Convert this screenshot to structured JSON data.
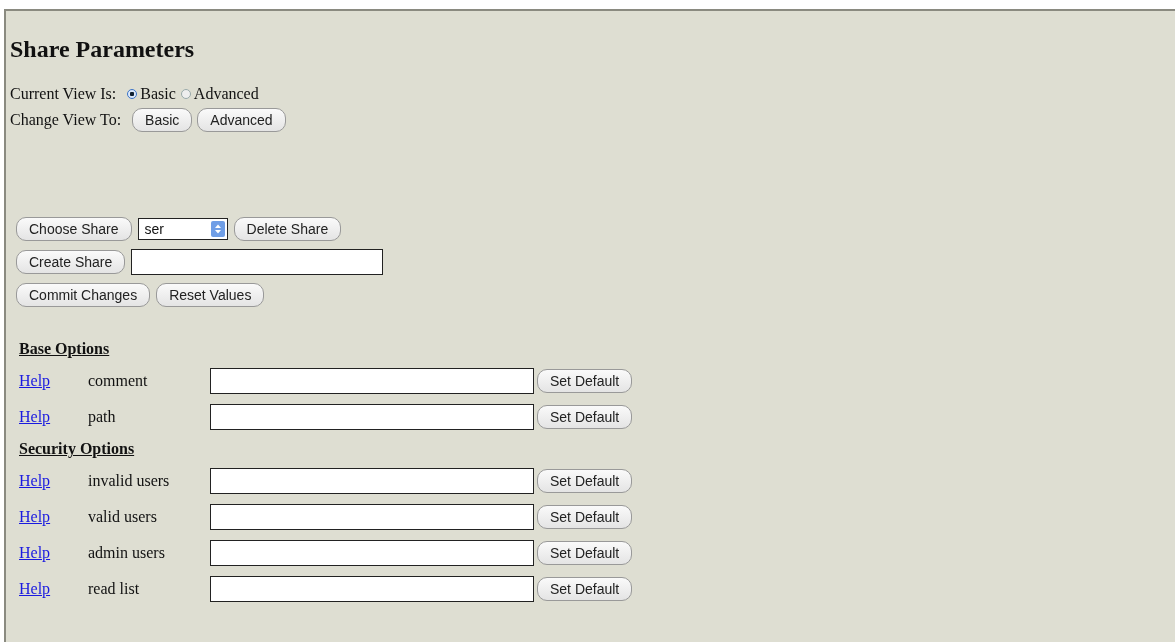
{
  "title": "Share Parameters",
  "current_view": {
    "label": "Current View Is:",
    "options": [
      {
        "label": "Basic",
        "selected": true
      },
      {
        "label": "Advanced",
        "selected": false
      }
    ]
  },
  "change_view": {
    "label": "Change View To:",
    "buttons": [
      "Basic",
      "Advanced"
    ]
  },
  "share_controls": {
    "choose_button": "Choose Share",
    "share_select": {
      "value": "ser"
    },
    "delete_button": "Delete Share",
    "create_button": "Create Share",
    "commit_button": "Commit Changes",
    "reset_button": "Reset Values"
  },
  "sections": [
    {
      "heading": "Base Options",
      "rows": [
        {
          "help": "Help",
          "label": "comment",
          "button": "Set Default"
        },
        {
          "help": "Help",
          "label": "path",
          "button": "Set Default"
        }
      ]
    },
    {
      "heading": "Security Options",
      "rows": [
        {
          "help": "Help",
          "label": "invalid users",
          "button": "Set Default"
        },
        {
          "help": "Help",
          "label": "valid users",
          "button": "Set Default"
        },
        {
          "help": "Help",
          "label": "admin users",
          "button": "Set Default"
        },
        {
          "help": "Help",
          "label": "read list",
          "button": "Set Default"
        }
      ]
    }
  ]
}
